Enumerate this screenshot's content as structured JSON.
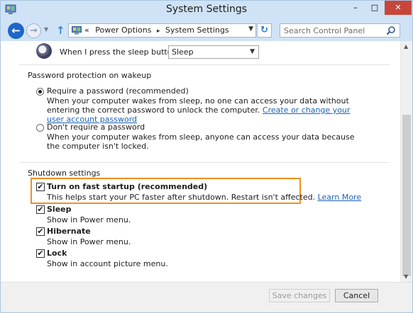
{
  "window": {
    "title": "System Settings",
    "minimize_glyph": "–",
    "maximize_glyph": "□",
    "close_glyph": "✕"
  },
  "nav": {
    "breadcrumbs": [
      "Power Options",
      "System Settings"
    ],
    "crumb_prefix": "«",
    "crumb_sep": "▸",
    "search_placeholder": "Search Control Panel"
  },
  "sleep": {
    "label": "When I press the sleep button:",
    "value": "Sleep"
  },
  "password": {
    "title": "Password protection on wakeup",
    "options": [
      {
        "label": "Require a password (recommended)",
        "desc": "When your computer wakes from sleep, no one can access your data without entering the correct password to unlock the computer.",
        "link": "Create or change your user account password",
        "selected": true
      },
      {
        "label": "Don't require a password",
        "desc": "When your computer wakes from sleep, anyone can access your data because the computer isn't locked.",
        "selected": false
      }
    ]
  },
  "shutdown": {
    "title": "Shutdown settings",
    "items": [
      {
        "label": "Turn on fast startup (recommended)",
        "desc": "This helps start your PC faster after shutdown. Restart isn't affected.",
        "link": "Learn More",
        "checked": true
      },
      {
        "label": "Sleep",
        "desc": "Show in Power menu.",
        "checked": true
      },
      {
        "label": "Hibernate",
        "desc": "Show in Power menu.",
        "checked": true
      },
      {
        "label": "Lock",
        "desc": "Show in account picture menu.",
        "checked": true
      }
    ],
    "check_glyph": "✔"
  },
  "footer": {
    "save_label": "Save changes",
    "cancel_label": "Cancel"
  },
  "colors": {
    "accent_blue": "#1e67c8",
    "link": "#1e63b5",
    "highlight": "#f0901f",
    "close_red": "#c7463c",
    "chrome": "#cfe2f6"
  }
}
